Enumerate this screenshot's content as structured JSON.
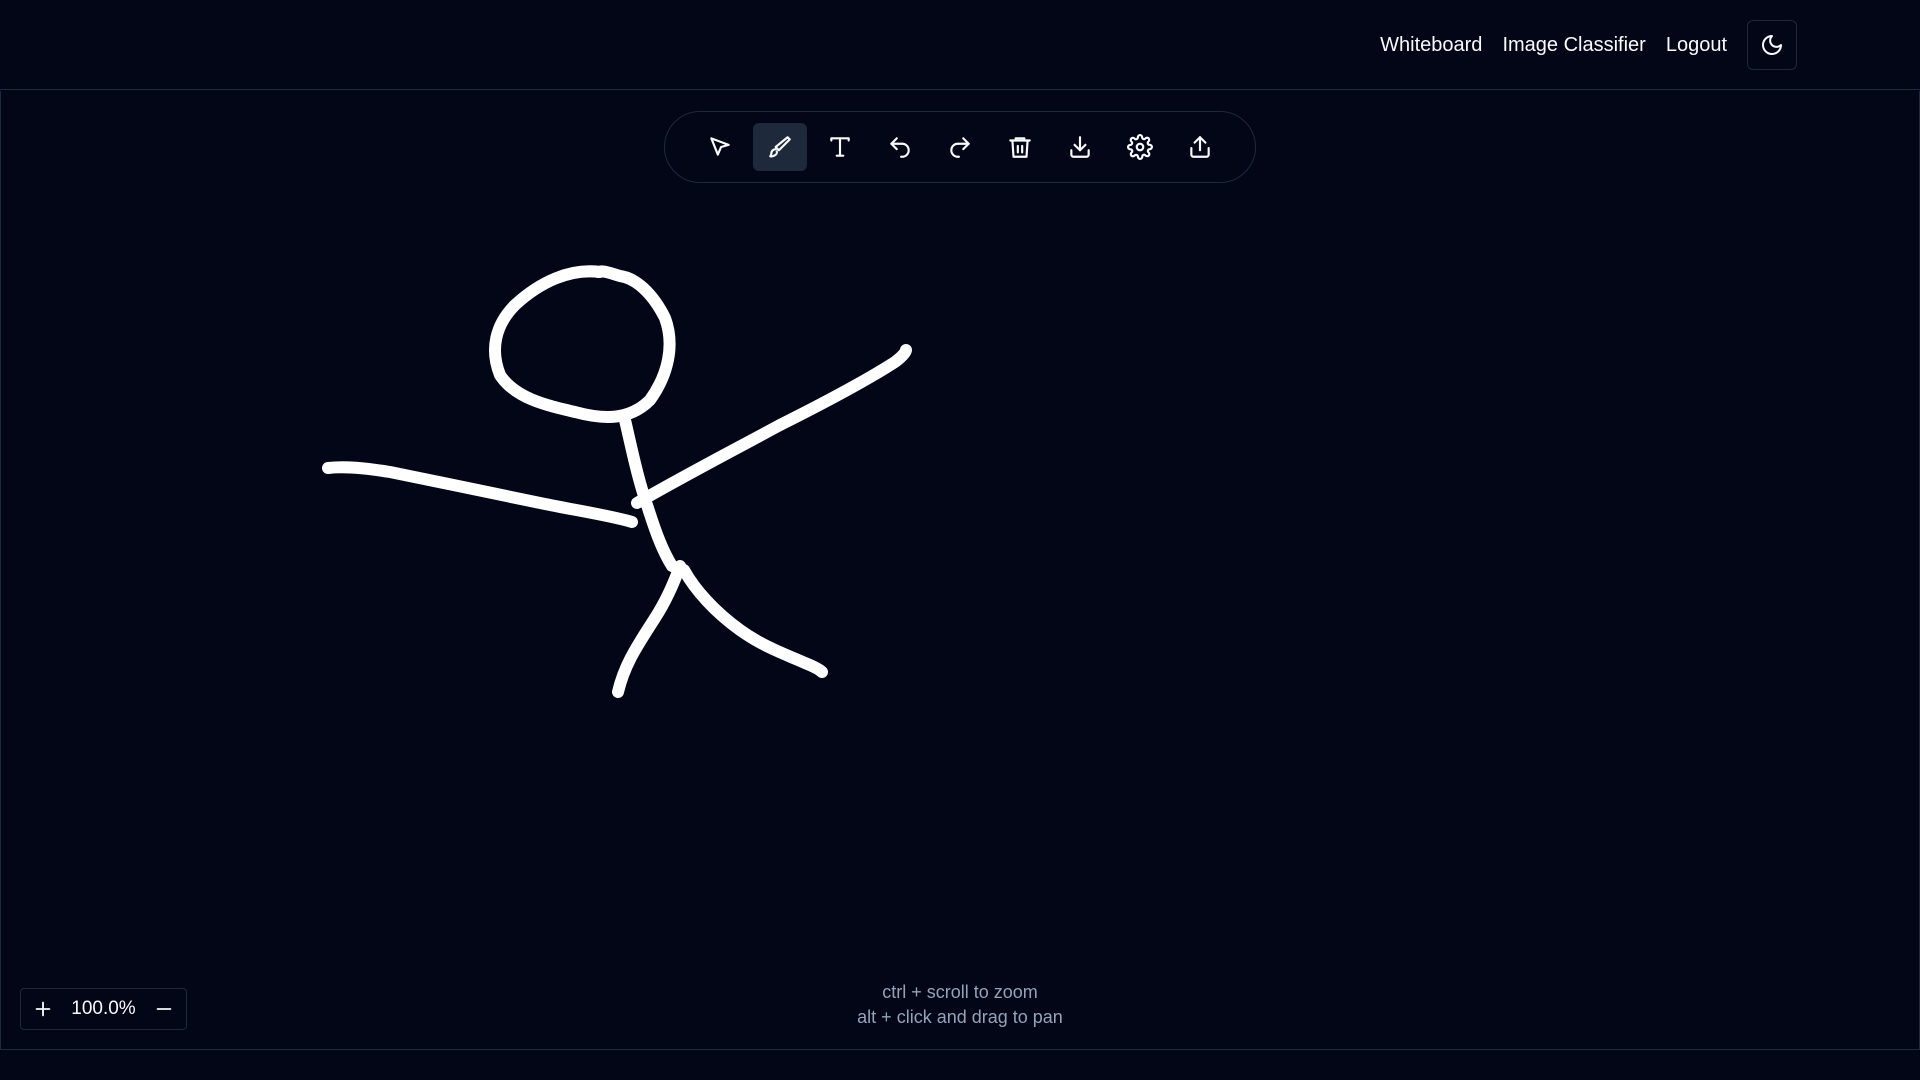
{
  "nav": {
    "whiteboard": "Whiteboard",
    "image_classifier": "Image Classifier",
    "logout": "Logout",
    "theme_icon": "moon-icon"
  },
  "toolbar": {
    "tools": [
      {
        "icon": "pointer-icon",
        "active": false
      },
      {
        "icon": "brush-icon",
        "active": true
      },
      {
        "icon": "text-icon",
        "active": false
      },
      {
        "icon": "undo-icon",
        "active": false
      },
      {
        "icon": "redo-icon",
        "active": false
      },
      {
        "icon": "trash-icon",
        "active": false
      },
      {
        "icon": "download-icon",
        "active": false
      },
      {
        "icon": "gear-icon",
        "active": false
      },
      {
        "icon": "share-icon",
        "active": false
      }
    ]
  },
  "zoom": {
    "level": "100.0%"
  },
  "hints": {
    "zoom": "ctrl + scroll to zoom",
    "pan": "alt + click and drag to pan"
  },
  "colors": {
    "background": "#020617",
    "border": "#1e293b",
    "stroke": "#ffffff",
    "text": "#f8fafc",
    "muted": "#94a3b8"
  }
}
